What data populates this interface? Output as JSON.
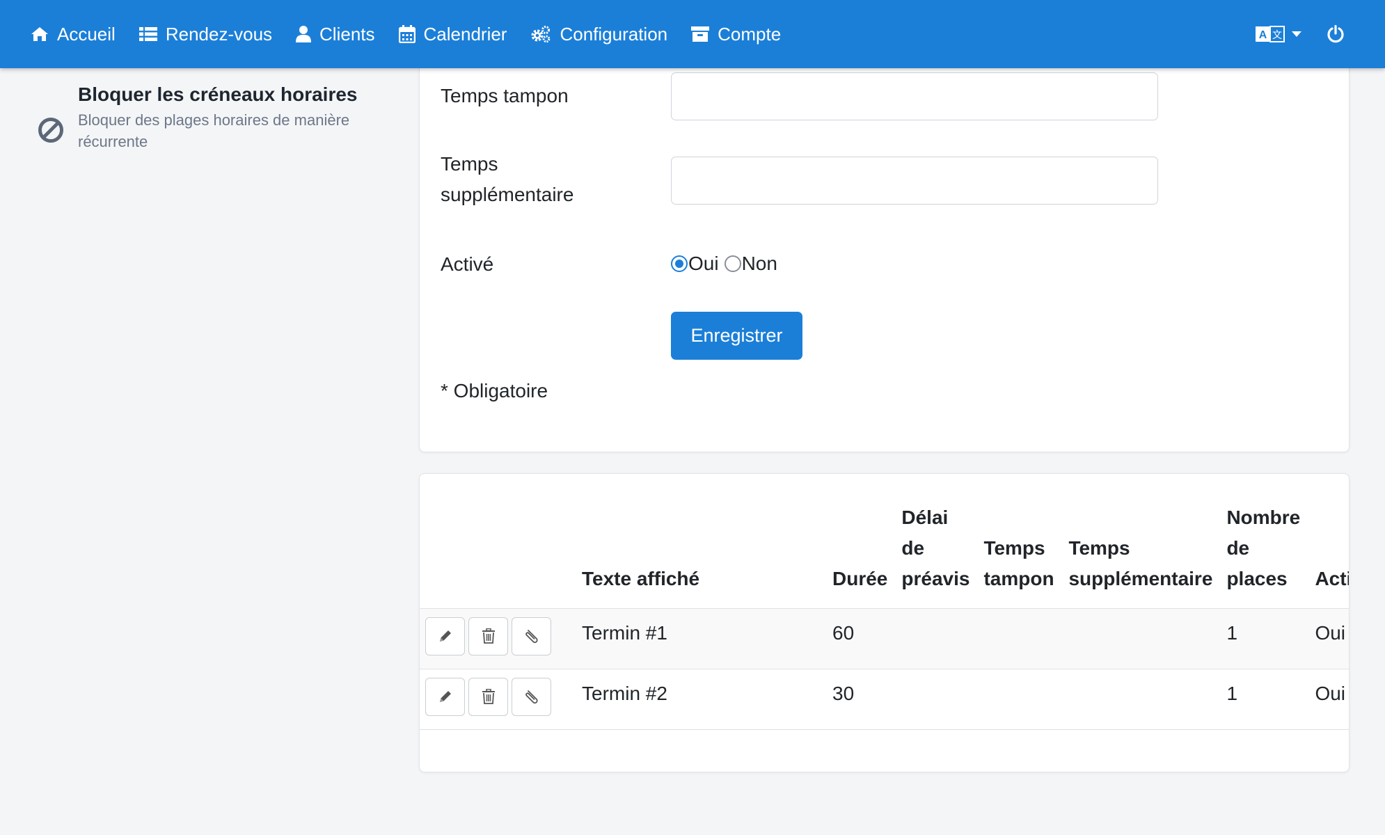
{
  "nav": {
    "items": [
      {
        "label": "Accueil",
        "icon": "home-icon"
      },
      {
        "label": "Rendez-vous",
        "icon": "list-icon"
      },
      {
        "label": "Clients",
        "icon": "user-icon"
      },
      {
        "label": "Calendrier",
        "icon": "calendar-icon"
      },
      {
        "label": "Configuration",
        "icon": "cogs-icon"
      },
      {
        "label": "Compte",
        "icon": "archive-icon"
      }
    ],
    "language_icon": "language-icon",
    "power_icon": "power-icon",
    "color": "#1b7fd8"
  },
  "sidebar": {
    "icon": "ban-icon",
    "title": "Bloquer les créneaux horaires",
    "description": "Bloquer des plages horaires de manière récurrente"
  },
  "form": {
    "buffer_label": "Temps tampon",
    "buffer_value": "",
    "extra_label": "Temps supplémentaire",
    "extra_value": "",
    "active_label": "Activé",
    "active_options": [
      "Oui",
      "Non"
    ],
    "active_selected": "Oui",
    "save_label": "Enregistrer",
    "required_note": "* Obligatoire"
  },
  "table": {
    "columns": [
      "",
      "Texte affiché",
      "Durée",
      "Délai de préavis",
      "Temps tampon",
      "Temps supplémentaire",
      "Nombre de places",
      "Activé"
    ],
    "rows": [
      {
        "text": "Termin #1",
        "duration": "60",
        "notice": "",
        "buffer": "",
        "extra": "",
        "places": "1",
        "active": "Oui"
      },
      {
        "text": "Termin #2",
        "duration": "30",
        "notice": "",
        "buffer": "",
        "extra": "",
        "places": "1",
        "active": "Oui"
      }
    ],
    "row_actions": [
      "edit-icon",
      "trash-icon",
      "paperclip-icon"
    ]
  }
}
